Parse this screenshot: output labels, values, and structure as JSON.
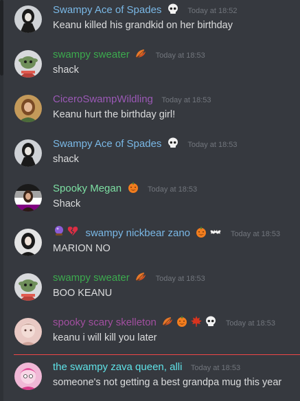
{
  "channel": {
    "messages": [
      {
        "username": "Swampy Ace of Spades",
        "name_color": "#7ab8e6",
        "badges_after": [
          "skull-icon"
        ],
        "timestamp": "Today at 18:52",
        "text": "Keanu killed his grandkid on her birthday"
      },
      {
        "username": "swampy sweater",
        "name_color": "#3cab4e",
        "badges_after": [
          "autumn-leaves-icon"
        ],
        "timestamp": "Today at 18:53",
        "text": "shack"
      },
      {
        "username": "CiceroSwampWildling",
        "name_color": "#9b59b6",
        "badges_after": [],
        "timestamp": "Today at 18:53",
        "text": "Keanu hurt the birthday girl!"
      },
      {
        "username": "Swampy Ace of Spades",
        "name_color": "#7ab8e6",
        "badges_after": [
          "skull-icon"
        ],
        "timestamp": "Today at 18:53",
        "text": "shack"
      },
      {
        "username": "Spooky Megan",
        "name_color": "#7de0a3",
        "badges_after": [
          "jack-o-lantern-icon"
        ],
        "timestamp": "Today at 18:53",
        "text": "Shack"
      },
      {
        "username": "swampy nickbear zano",
        "name_color": "#7ab8e6",
        "badges_before": [
          "crystal-ball-icon",
          "broken-heart-icon"
        ],
        "badges_after": [
          "jack-o-lantern-icon",
          "bat-icon"
        ],
        "timestamp": "Today at 18:53",
        "text": "MARION NO"
      },
      {
        "username": "swampy sweater",
        "name_color": "#3cab4e",
        "badges_after": [
          "autumn-leaves-icon"
        ],
        "timestamp": "Today at 18:53",
        "text": "BOO KEANU"
      },
      {
        "username": "spooky scary skelleton",
        "name_color": "#a24fa0",
        "badges_after": [
          "autumn-leaves-icon",
          "jack-o-lantern-icon",
          "maple-leaf-icon",
          "skull-icon"
        ],
        "timestamp": "Today at 18:53",
        "text": "keanu i will kill you later"
      },
      {
        "username": "the swampy zava queen, alli",
        "name_color": "#5fe3e8",
        "badges_after": [],
        "timestamp": "Today at 18:53",
        "text": "someone's not getting a best grandpa mug this year"
      }
    ]
  }
}
